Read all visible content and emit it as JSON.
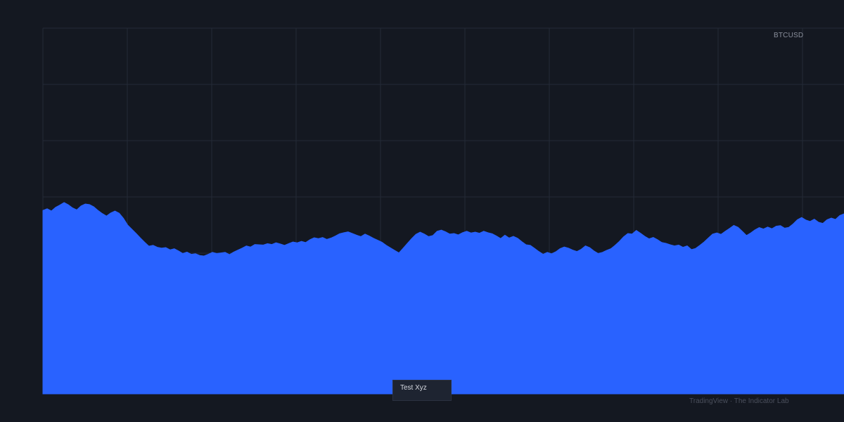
{
  "symbol": "BTCUSD",
  "tooltip": "Test Xyz",
  "watermark": "TradingView · The Indicator Lab",
  "colors": {
    "background": "#141821",
    "grid": "#242a36",
    "area_fill": "#2962ff",
    "tooltip_bg": "#1e2431"
  },
  "chart_data": {
    "type": "area",
    "series": [
      {
        "values": [
          65.2,
          65.8,
          65.0,
          66.3,
          67.1,
          68.0,
          67.2,
          66.1,
          65.4,
          66.8,
          67.5,
          67.3,
          66.5,
          65.2,
          64.1,
          63.2,
          64.3,
          65.0,
          64.2,
          62.4,
          60.0,
          58.5,
          57.0,
          55.4,
          53.9,
          52.5,
          52.8,
          52.1,
          51.8,
          52.0,
          51.2,
          51.6,
          50.8,
          49.9,
          50.4,
          49.6,
          49.8,
          49.2,
          49.0,
          49.6,
          50.3,
          49.9,
          50.1,
          50.3,
          49.5,
          50.4,
          51.1,
          51.8,
          52.6,
          52.2,
          53.1,
          53.0,
          52.9,
          53.4,
          53.1,
          53.7,
          53.3,
          52.8,
          53.4,
          54.0,
          53.7,
          54.2,
          53.8,
          54.8,
          55.5,
          55.2,
          55.6,
          54.9,
          55.4,
          56.1,
          56.9,
          57.3,
          57.6,
          57.0,
          56.4,
          55.9,
          56.8,
          56.1,
          55.3,
          54.6,
          53.9,
          52.8,
          51.9,
          51.0,
          50.1,
          51.8,
          53.5,
          55.2,
          56.7,
          57.5,
          56.8,
          55.9,
          56.3,
          57.8,
          58.2,
          57.6,
          56.8,
          57.0,
          56.5,
          57.3,
          57.8,
          57.2,
          57.5,
          57.1,
          57.8,
          57.3,
          56.9,
          56.1,
          55.2,
          56.4,
          55.4,
          56.0,
          55.3,
          54.1,
          53.0,
          52.8,
          51.7,
          50.6,
          49.6,
          50.3,
          49.8,
          50.5,
          51.6,
          52.2,
          51.8,
          51.1,
          50.6,
          51.4,
          52.6,
          52.0,
          50.8,
          49.9,
          50.3,
          51.0,
          51.6,
          52.8,
          54.2,
          55.8,
          57.0,
          56.8,
          58.1,
          57.1,
          56.0,
          55.1,
          55.6,
          54.8,
          53.8,
          53.5,
          53.0,
          52.6,
          52.9,
          52.1,
          52.6,
          51.3,
          51.7,
          52.8,
          54.0,
          55.4,
          56.8,
          57.2,
          56.7,
          57.8,
          58.8,
          59.9,
          59.2,
          57.8,
          56.3,
          57.2,
          58.3,
          59.1,
          58.6,
          59.3,
          58.7,
          59.6,
          59.8,
          58.9,
          59.2,
          60.4,
          61.9,
          62.7,
          61.8,
          61.3,
          62.1,
          61.0,
          60.6,
          61.9,
          62.5,
          62.0,
          63.4,
          64.0
        ]
      }
    ],
    "y_range": [
      0,
      130
    ],
    "x_gridlines": 10,
    "y_gridlines": 6,
    "grid": true,
    "legend": false
  }
}
